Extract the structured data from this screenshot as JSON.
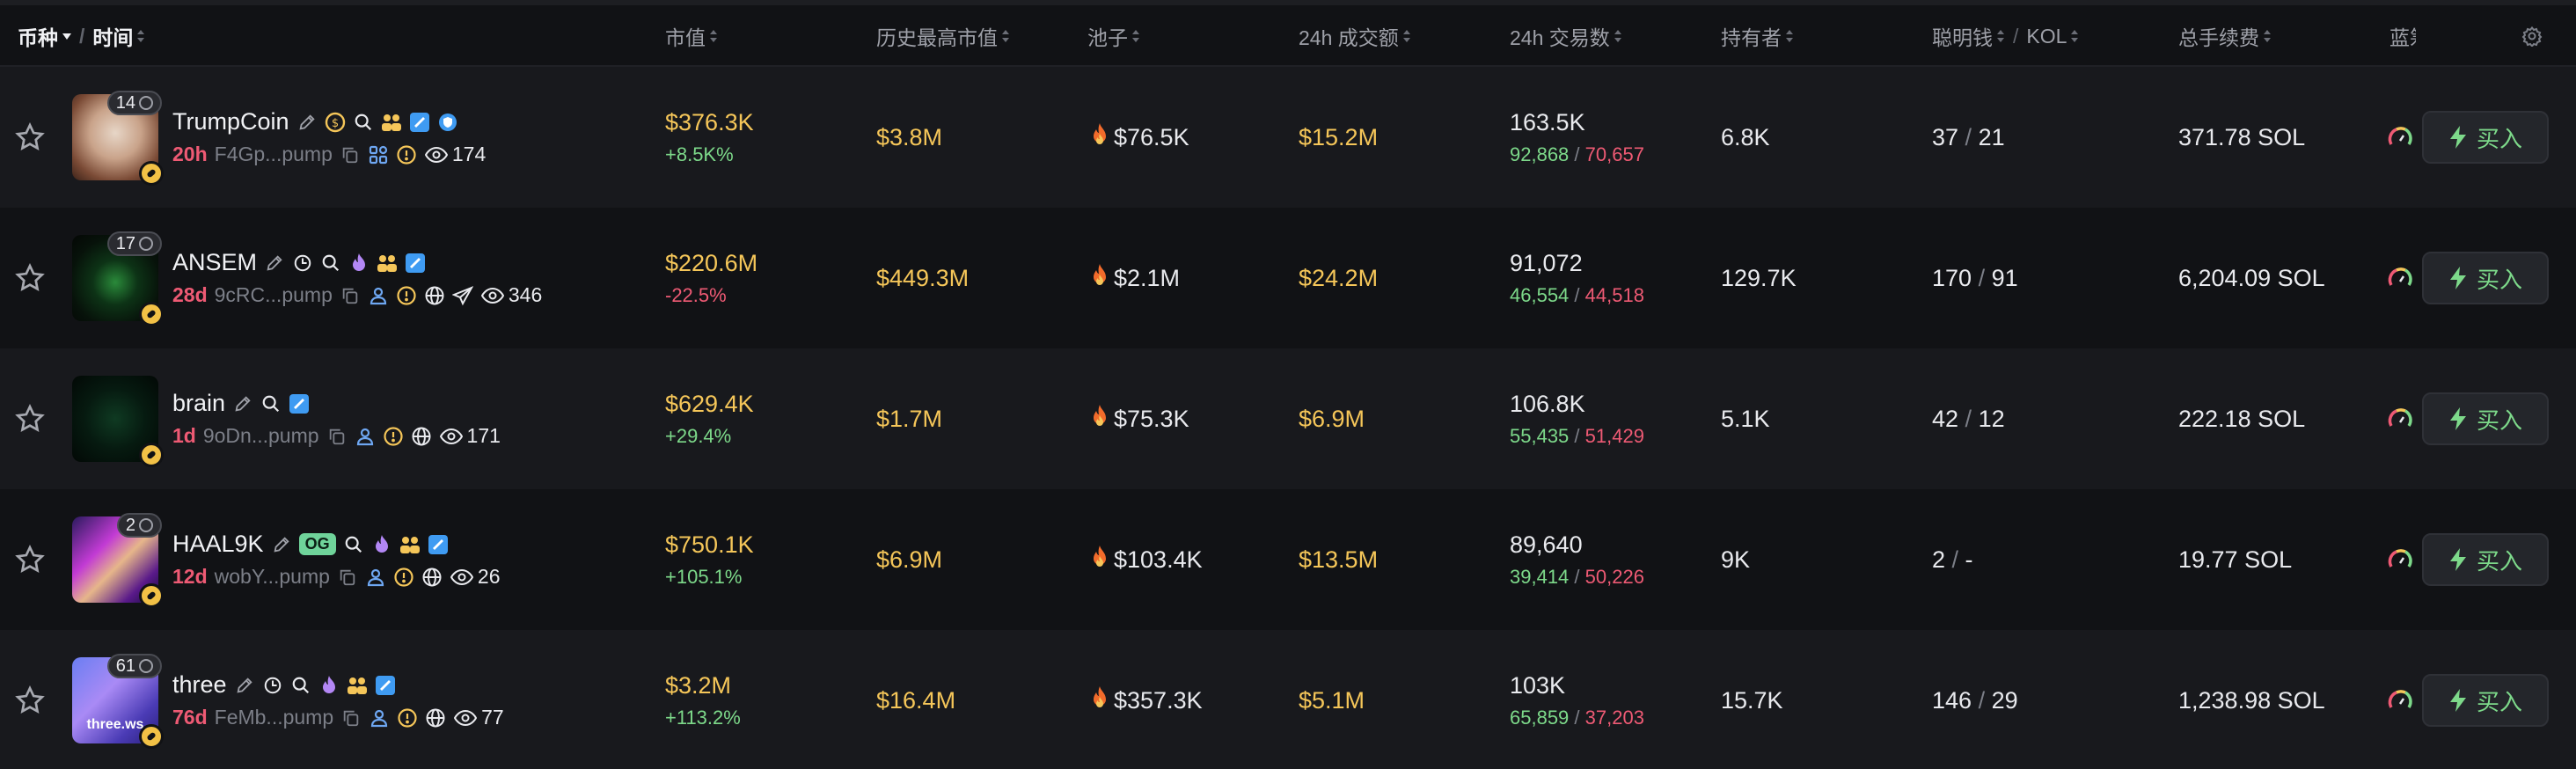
{
  "header": {
    "coin_label": "币种",
    "time_label": "时间",
    "mcap_label": "市值",
    "ath_label": "历史最高市值",
    "pool_label": "池子",
    "vol_label": "24h 成交额",
    "txs_label": "24h 交易数",
    "holders_label": "持有者",
    "smart_label": "聪明钱",
    "kol_label": "KOL",
    "fees_label": "总手续费",
    "blue_label": "蓝筹"
  },
  "buy_label": "买入",
  "rows": [
    {
      "name": "TrumpCoin",
      "holders_pill": "14",
      "age": "20h",
      "addr": "F4Gp...pump",
      "views": "174",
      "mcap": "$376.3K",
      "change": "+8.5K%",
      "change_dir": "up",
      "ath": "$3.8M",
      "pool": "$76.5K",
      "vol": "$15.2M",
      "txs": "163.5K",
      "buys": "92,868",
      "sells": "70,657",
      "holders": "6.8K",
      "smart": "37",
      "kol": "21",
      "fees": "371.78 SOL"
    },
    {
      "name": "ANSEM",
      "holders_pill": "17",
      "age": "28d",
      "addr": "9cRC...pump",
      "views": "346",
      "mcap": "$220.6M",
      "change": "-22.5%",
      "change_dir": "down",
      "ath": "$449.3M",
      "pool": "$2.1M",
      "vol": "$24.2M",
      "txs": "91,072",
      "buys": "46,554",
      "sells": "44,518",
      "holders": "129.7K",
      "smart": "170",
      "kol": "91",
      "fees": "6,204.09 SOL"
    },
    {
      "name": "brain",
      "holders_pill": "",
      "age": "1d",
      "addr": "9oDn...pump",
      "views": "171",
      "mcap": "$629.4K",
      "change": "+29.4%",
      "change_dir": "up",
      "ath": "$1.7M",
      "pool": "$75.3K",
      "vol": "$6.9M",
      "txs": "106.8K",
      "buys": "55,435",
      "sells": "51,429",
      "holders": "5.1K",
      "smart": "42",
      "kol": "12",
      "fees": "222.18 SOL"
    },
    {
      "name": "HAAL9K",
      "holders_pill": "2",
      "og": "OG",
      "age": "12d",
      "addr": "wobY...pump",
      "views": "26",
      "mcap": "$750.1K",
      "change": "+105.1%",
      "change_dir": "up",
      "ath": "$6.9M",
      "pool": "$103.4K",
      "vol": "$13.5M",
      "txs": "89,640",
      "buys": "39,414",
      "sells": "50,226",
      "holders": "9K",
      "smart": "2",
      "kol": "-",
      "fees": "19.77 SOL"
    },
    {
      "name": "three",
      "holders_pill": "61",
      "avatar_text": "three.ws",
      "age": "76d",
      "addr": "FeMb...pump",
      "views": "77",
      "mcap": "$3.2M",
      "change": "+113.2%",
      "change_dir": "up",
      "ath": "$16.4M",
      "pool": "$357.3K",
      "vol": "$5.1M",
      "txs": "103K",
      "buys": "65,859",
      "sells": "37,203",
      "holders": "15.7K",
      "smart": "146",
      "kol": "29",
      "fees": "1,238.98 SOL"
    }
  ],
  "colors": {
    "accent_yellow": "#f5c659",
    "up_green": "#7dd98a",
    "down_red": "#ee5a74",
    "age_red": "#ee5a74"
  }
}
